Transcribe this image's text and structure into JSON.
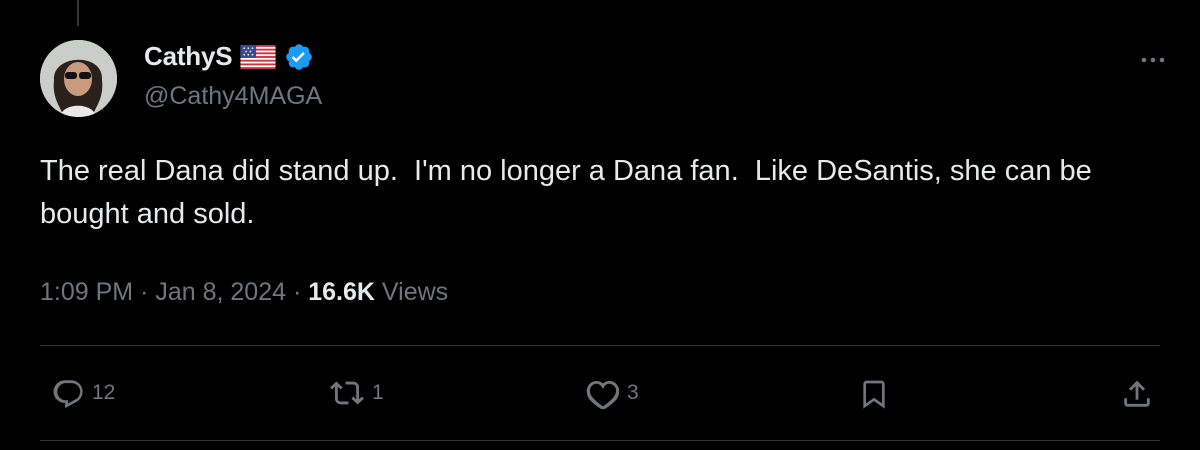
{
  "tweet": {
    "display_name": "CathyS",
    "handle": "@Cathy4MAGA",
    "text": "The real Dana did stand up.  I'm no longer a Dana fan.  Like DeSantis, she can be bought and sold.",
    "time": "1:09 PM",
    "separator": "·",
    "date": "Jan 8, 2024",
    "views_count": "16.6K",
    "views_label": "Views"
  },
  "actions": {
    "replies": "12",
    "reposts": "1",
    "likes": "3"
  },
  "icons": {
    "name_flag": "us-flag-icon",
    "verified": "verified-badge-icon",
    "more": "more-options-icon",
    "reply": "reply-icon",
    "repost": "repost-icon",
    "like": "heart-icon",
    "bookmark": "bookmark-icon",
    "share": "share-icon"
  },
  "colors": {
    "background": "#000000",
    "text_primary": "#e7e9ea",
    "text_secondary": "#71767b",
    "verified_blue": "#1d9bf0",
    "divider": "#2f3336"
  }
}
